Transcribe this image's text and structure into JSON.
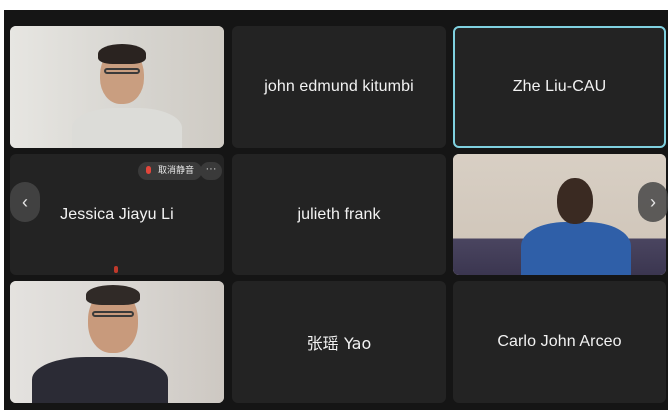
{
  "participants": [
    {
      "name": "john edmund kitumbi"
    },
    {
      "name": "Zhe Liu-CAU"
    },
    {
      "name": "Jessica Jiayu Li"
    },
    {
      "name": "julieth frank"
    },
    {
      "name": "张瑶 Yao"
    },
    {
      "name": "Carlo John Arceo"
    }
  ],
  "controls": {
    "unmute_label": "取消静音",
    "more_label": "···",
    "prev_label": "‹",
    "next_label": "›"
  },
  "colors": {
    "active_speaker_border": "#7fd0df",
    "tile_background": "#232323",
    "meeting_background": "#151515",
    "muted_mic": "#e2463b"
  }
}
